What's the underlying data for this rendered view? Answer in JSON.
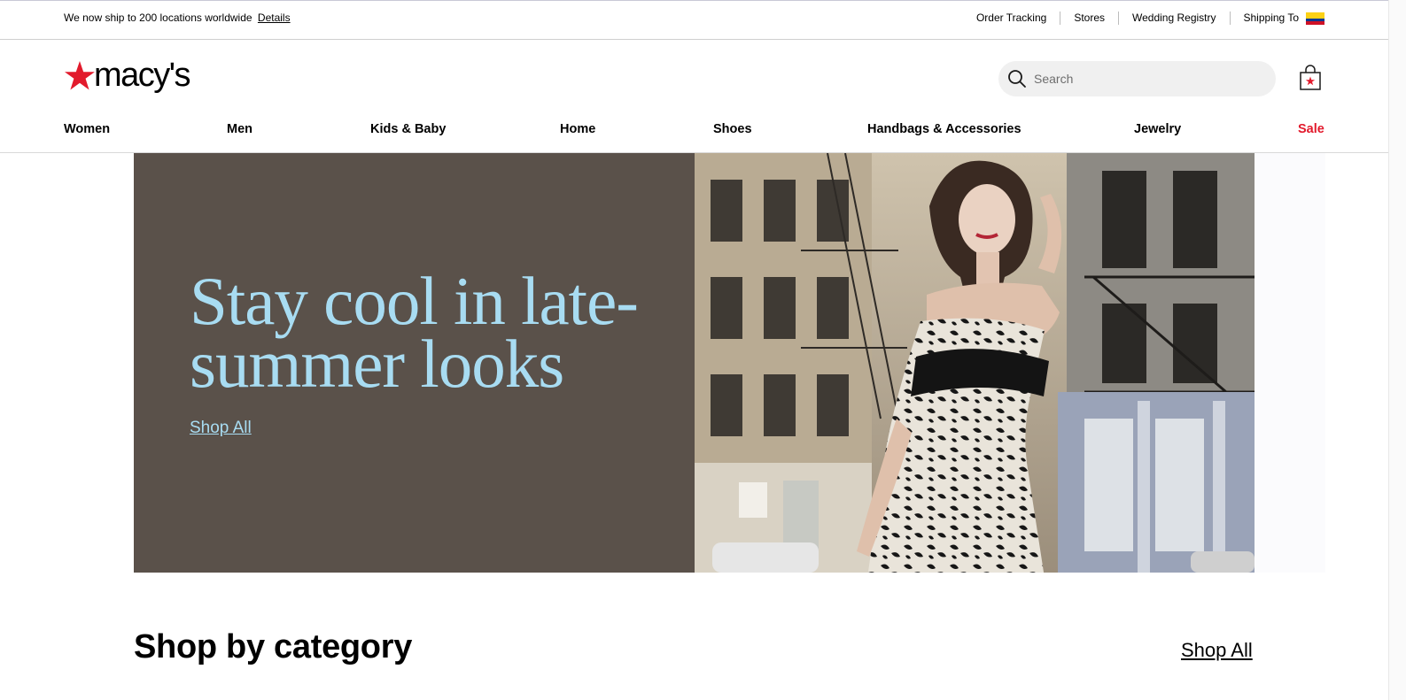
{
  "utility_bar": {
    "shipping_message": "We now ship to 200 locations worldwide",
    "details_link": "Details",
    "links": [
      "Order Tracking",
      "Stores",
      "Wedding Registry"
    ],
    "shipping_to_label": "Shipping To",
    "flag_icon": "colombia-flag-icon"
  },
  "header": {
    "logo_text": "macy's",
    "logo_icon": "red-star-icon",
    "search": {
      "placeholder": "Search",
      "value": "",
      "icon": "search-icon"
    },
    "bag_icon": "shopping-bag-icon"
  },
  "nav": {
    "items": [
      "Women",
      "Men",
      "Kids & Baby",
      "Home",
      "Shoes",
      "Handbags & Accessories",
      "Jewelry",
      "Sale"
    ]
  },
  "hero": {
    "heading": "Stay cool in late-summer looks",
    "link": "Shop All",
    "image": "woman-in-black-and-white-slip-dress-on-city-street"
  },
  "section": {
    "title": "Shop by category",
    "link": "Shop All"
  },
  "colors": {
    "brand_red": "#e21a2c",
    "hero_panel": "#5a514a",
    "hero_text": "#a8dcf2"
  }
}
